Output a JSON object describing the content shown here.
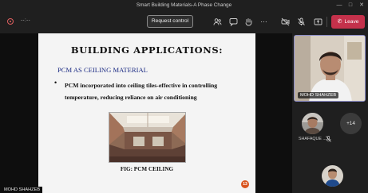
{
  "window": {
    "title": "Smart Building Materials-A Phase Change"
  },
  "toolbar": {
    "timer": "--:--",
    "request_control_label": "Request control",
    "leave_label": "Leave",
    "icons": [
      "participants-icon",
      "chat-icon",
      "raise-hand-icon",
      "more-options-icon",
      "camera-off-icon",
      "mic-off-icon",
      "share-tray-icon"
    ]
  },
  "slide": {
    "title": "BUILDING APPLICATIONS:",
    "subtitle": "PCM AS CEILING MATERIAL",
    "bullet": "PCM incorporated into ceiling tiles-effective in controlling temperature, reducing reliance on air conditioning",
    "caption": "FIG: PCM CEILING",
    "page_number": "13"
  },
  "stage": {
    "presenter_name": "MOHD SHAHZEB"
  },
  "participants": {
    "main_tile_name": "MOHD SHAHZEB",
    "second_name": "SHAFAQUE ...",
    "more_count": "+14"
  },
  "colors": {
    "leave": "#c4314b",
    "subtitle": "#1d2c84",
    "active_tile_border": "#8b8cc7"
  }
}
